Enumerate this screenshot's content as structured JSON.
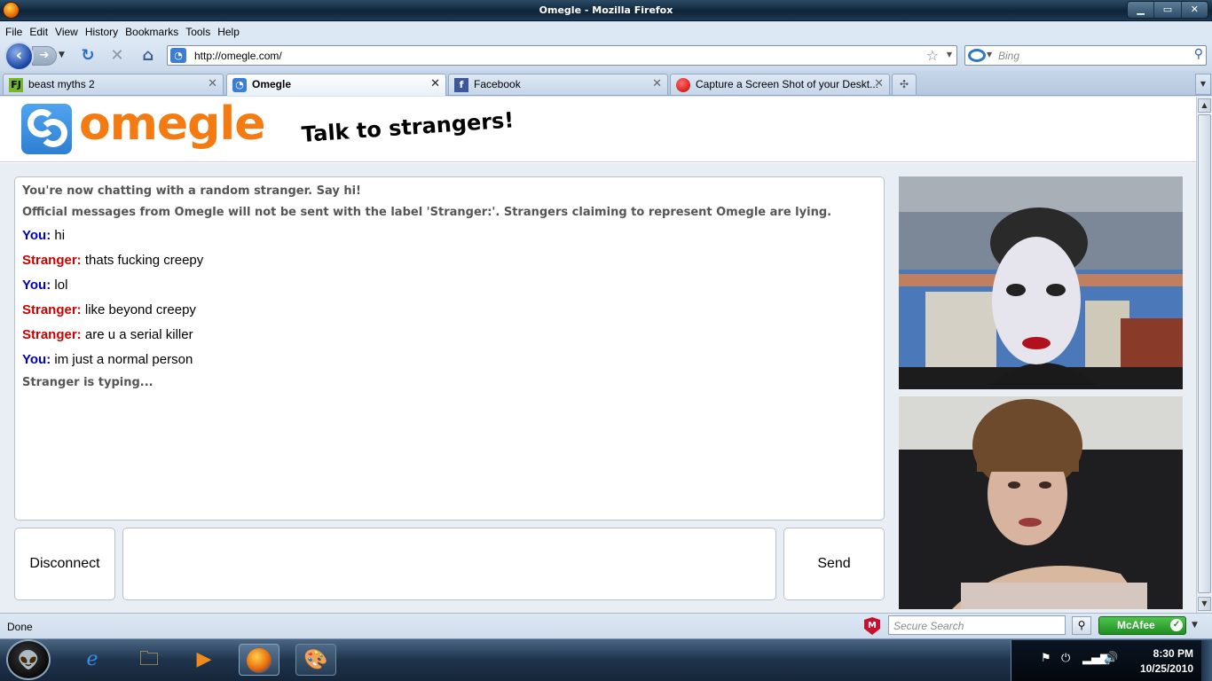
{
  "window": {
    "title": "Omegle - Mozilla Firefox"
  },
  "menu": [
    "File",
    "Edit",
    "View",
    "History",
    "Bookmarks",
    "Tools",
    "Help"
  ],
  "nav": {
    "url": "http://omegle.com/",
    "search_placeholder": "Bing"
  },
  "tabs": [
    {
      "label": "beast myths 2",
      "icon": "funnyjunk-icon",
      "active": false
    },
    {
      "label": "Omegle",
      "icon": "omegle-icon",
      "active": true
    },
    {
      "label": "Facebook",
      "icon": "facebook-icon",
      "active": false
    },
    {
      "label": "Capture a Screen Shot of your Deskt...",
      "icon": "record-icon",
      "active": false
    }
  ],
  "page": {
    "logo_text": "omegle",
    "tagline": "Talk to strangers!",
    "system_messages": [
      "You're now chatting with a random stranger. Say hi!",
      "Official messages from Omegle will not be sent with the label 'Stranger:'. Strangers claiming to represent Omegle are lying."
    ],
    "messages": [
      {
        "sender": "You:",
        "text": "hi",
        "role": "you"
      },
      {
        "sender": "Stranger:",
        "text": "thats fucking creepy",
        "role": "stranger"
      },
      {
        "sender": "You:",
        "text": "lol",
        "role": "you"
      },
      {
        "sender": "Stranger:",
        "text": "like beyond creepy",
        "role": "stranger"
      },
      {
        "sender": "Stranger:",
        "text": "are u a serial killer",
        "role": "stranger"
      },
      {
        "sender": "You:",
        "text": "im just a normal person",
        "role": "you"
      }
    ],
    "typing_status": "Stranger is typing...",
    "disconnect_label": "Disconnect",
    "send_label": "Send",
    "colors": {
      "logo_orange": "#f37b12",
      "logo_blue": "#2f7fd3",
      "you": "#0000b3",
      "stranger": "#cc0000"
    }
  },
  "statusbar": {
    "status": "Done",
    "secure_search_placeholder": "Secure Search",
    "mcafee_label": "McAfee"
  },
  "taskbar": {
    "time": "8:30 PM",
    "date": "10/25/2010"
  }
}
